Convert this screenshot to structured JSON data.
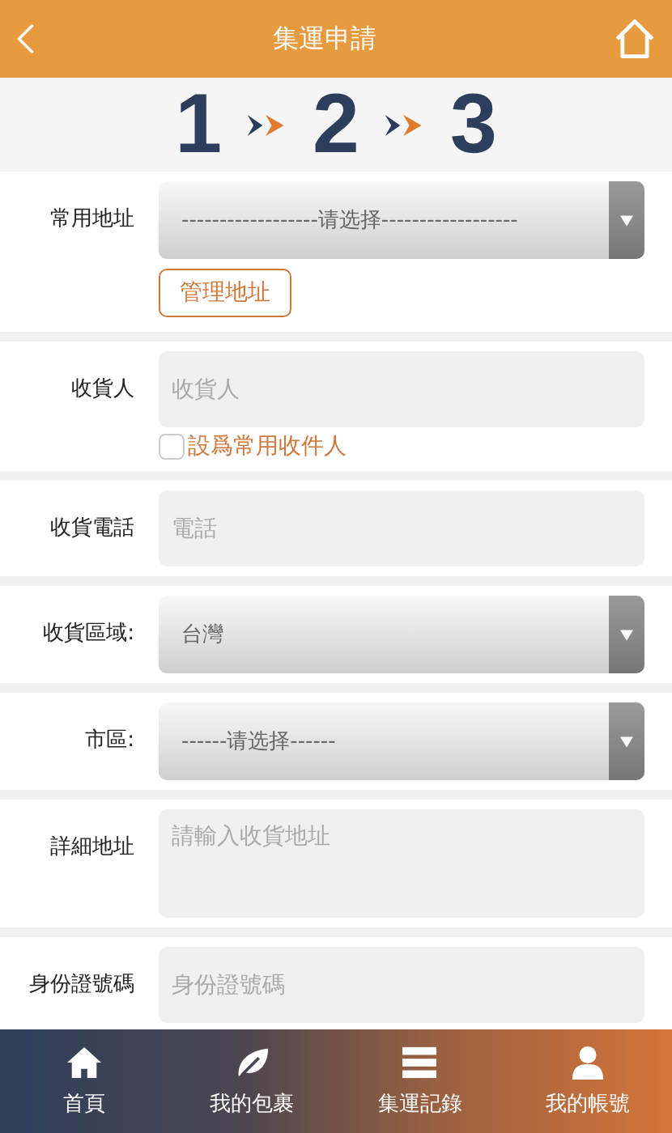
{
  "header": {
    "title": "集運申請"
  },
  "steps": [
    "1",
    "2",
    "3"
  ],
  "fields": [
    {
      "kind": "select",
      "label": "常用地址",
      "value": "------------------请选择------------------",
      "button": "管理地址"
    },
    {
      "kind": "text",
      "label": "收貨人",
      "placeholder": "收貨人",
      "checkbox": {
        "label": "設爲常用收件人",
        "checked": false
      }
    },
    {
      "kind": "text",
      "label": "收貨電話",
      "placeholder": "電話"
    },
    {
      "kind": "select",
      "label": "收貨區域:",
      "value": "台灣"
    },
    {
      "kind": "select",
      "label": "市區:",
      "value": "------请选择------"
    },
    {
      "kind": "textarea",
      "label": "詳細地址",
      "placeholder": "請輸入收貨地址"
    },
    {
      "kind": "text",
      "label": "身份證號碼",
      "placeholder": "身份證號碼"
    }
  ],
  "tabbar": [
    {
      "label": "首頁",
      "kind": "home"
    },
    {
      "label": "我的包裹",
      "kind": "leaf"
    },
    {
      "label": "集運記錄",
      "kind": "list"
    },
    {
      "label": "我的帳號",
      "kind": "user"
    }
  ]
}
